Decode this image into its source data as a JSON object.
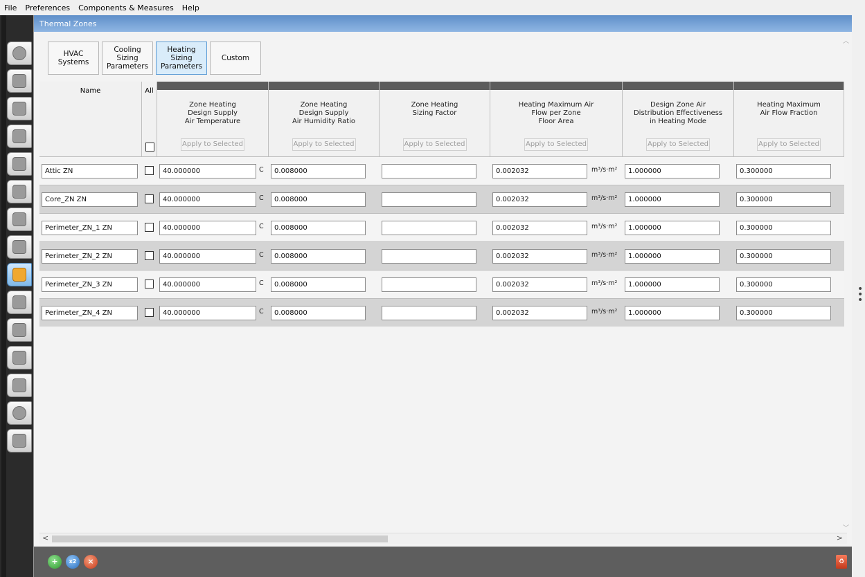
{
  "menu": [
    "File",
    "Preferences",
    "Components & Measures",
    "Help"
  ],
  "panel_title": "Thermal Zones",
  "subtabs": [
    {
      "label": "HVAC\nSystems",
      "active": false
    },
    {
      "label": "Cooling\nSizing\nParameters",
      "active": false
    },
    {
      "label": "Heating\nSizing\nParameters",
      "active": true
    },
    {
      "label": "Custom",
      "active": false
    }
  ],
  "sidebar_icons": [
    "site-icon",
    "schedules-icon",
    "constructions-icon",
    "loads-icon",
    "space-types-icon",
    "geometry-icon",
    "facility-icon",
    "spaces-icon",
    "thermal-zones-icon",
    "hvac-systems-icon",
    "variables-icon",
    "simulation-settings-icon",
    "measures-icon",
    "run-simulation-icon",
    "results-icon"
  ],
  "grid": {
    "name_header": "Name",
    "all_header": "All",
    "apply_label": "Apply to Selected",
    "columns": [
      "Zone Heating\nDesign Supply\nAir Temperature",
      "Zone Heating\nDesign Supply\nAir Humidity Ratio",
      "Zone Heating\nSizing Factor",
      "Heating Maximum Air\nFlow per Zone\nFloor Area",
      "Design Zone Air\nDistribution Effectiveness\nin Heating Mode",
      "Heating Maximum\nAir Flow Fraction"
    ],
    "units": {
      "temp": "C",
      "flow": "m³/s·m²"
    },
    "rows": [
      {
        "name": "Attic ZN",
        "temp": "40.000000",
        "humidity": "0.008000",
        "sizing": "",
        "flow": "0.002032",
        "effectiveness": "1.000000",
        "fraction": "0.300000"
      },
      {
        "name": "Core_ZN ZN",
        "temp": "40.000000",
        "humidity": "0.008000",
        "sizing": "",
        "flow": "0.002032",
        "effectiveness": "1.000000",
        "fraction": "0.300000"
      },
      {
        "name": "Perimeter_ZN_1 ZN",
        "temp": "40.000000",
        "humidity": "0.008000",
        "sizing": "",
        "flow": "0.002032",
        "effectiveness": "1.000000",
        "fraction": "0.300000"
      },
      {
        "name": "Perimeter_ZN_2 ZN",
        "temp": "40.000000",
        "humidity": "0.008000",
        "sizing": "",
        "flow": "0.002032",
        "effectiveness": "1.000000",
        "fraction": "0.300000"
      },
      {
        "name": "Perimeter_ZN_3 ZN",
        "temp": "40.000000",
        "humidity": "0.008000",
        "sizing": "",
        "flow": "0.002032",
        "effectiveness": "1.000000",
        "fraction": "0.300000"
      },
      {
        "name": "Perimeter_ZN_4 ZN",
        "temp": "40.000000",
        "humidity": "0.008000",
        "sizing": "",
        "flow": "0.002032",
        "effectiveness": "1.000000",
        "fraction": "0.300000"
      }
    ]
  },
  "bottom": {
    "add_icon": "add-icon",
    "copy_icon": "copy-icon",
    "copy_label": "x2",
    "remove_icon": "remove-icon",
    "purge_icon": "purge-icon"
  },
  "colors": {
    "title_bar": "#6f9fd6",
    "active_tab": "#d9ecfa",
    "sidebar": "#2b2b2b",
    "bottom_bar": "#5e5e5e"
  }
}
